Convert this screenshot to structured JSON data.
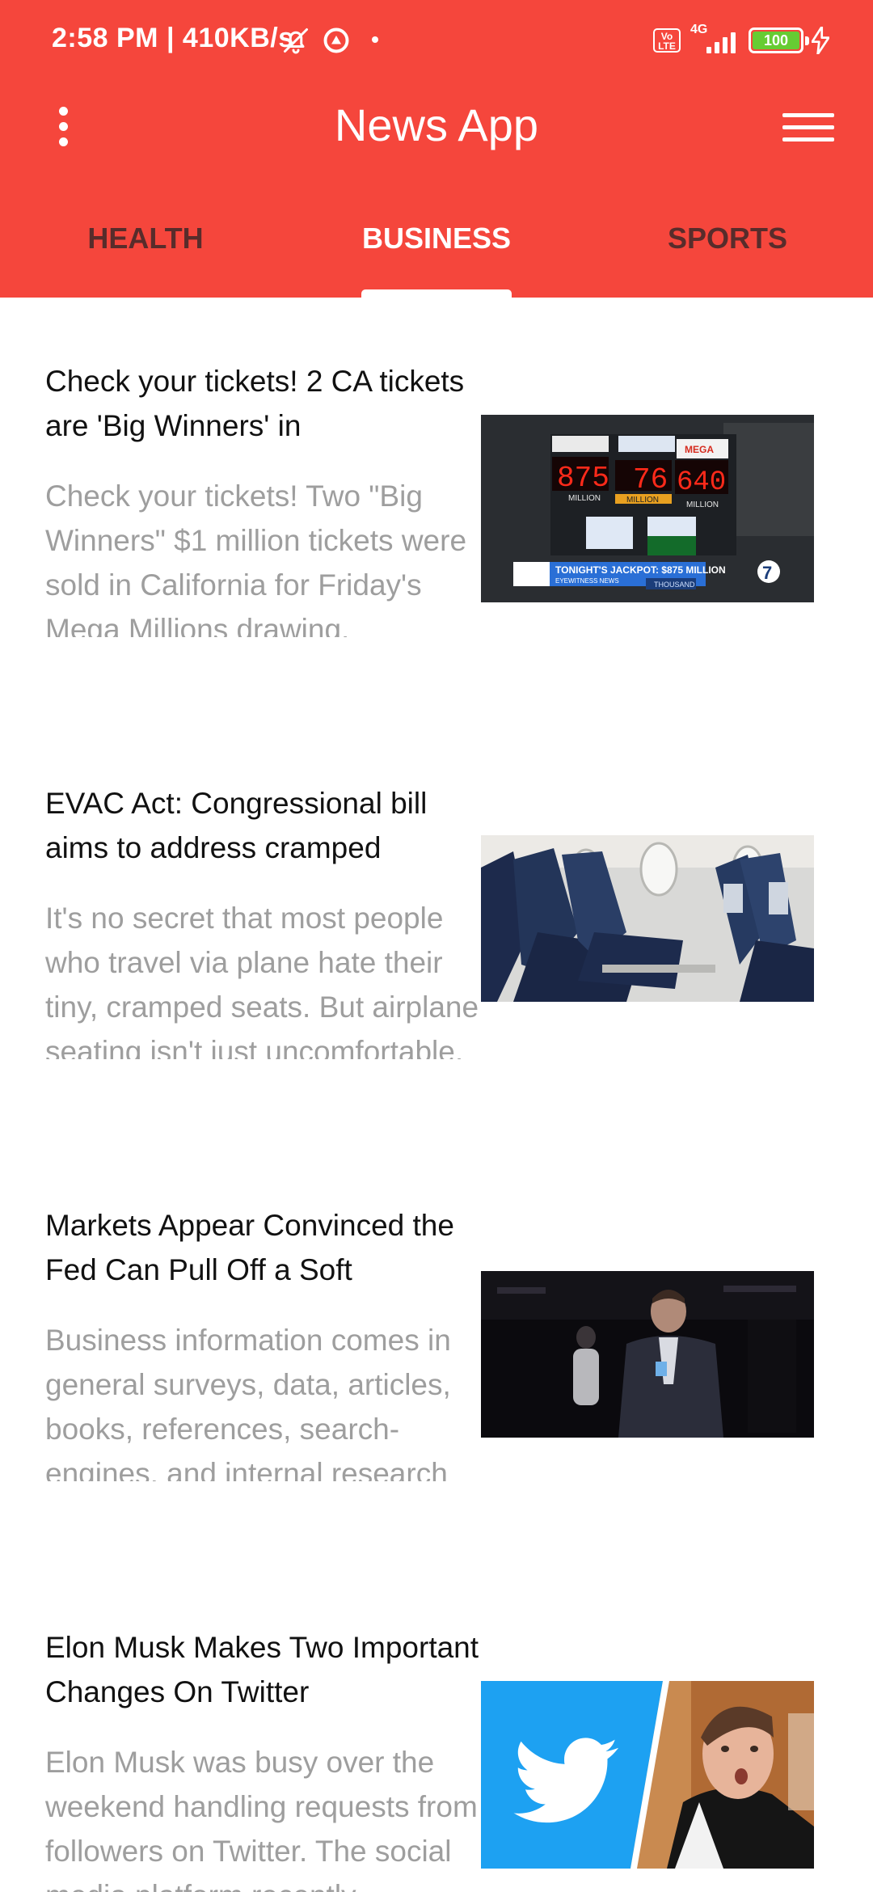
{
  "status_bar": {
    "time": "2:58 PM",
    "speed": "410KB/s",
    "network": "4G",
    "volte": "Vo LTE",
    "battery": "100"
  },
  "app_bar": {
    "title": "News App",
    "menu_icon": "kebab-menu-icon",
    "drawer_icon": "hamburger-icon"
  },
  "tabs": [
    {
      "label": "HEALTH",
      "active": false
    },
    {
      "label": "BUSINESS",
      "active": true
    },
    {
      "label": "SPORTS",
      "active": false
    }
  ],
  "articles": [
    {
      "title": "Check your tickets! 2 CA tickets are 'Big Winners' in",
      "description": "Check your tickets! Two \"Big Winners\" $1 million tickets were sold in California for Friday's Mega Millions drawing.",
      "image": {
        "jackpot_values": [
          "875",
          "76",
          "640"
        ],
        "jackpot_units": [
          "MILLION",
          "MILLION",
          "MILLION"
        ],
        "banner": "TONIGHT'S JACKPOT: $875 MILLION",
        "banner_sub": "EYEWITNESS NEWS",
        "thousand": "THOUSAND",
        "channel": "7"
      }
    },
    {
      "title": "EVAC Act: Congressional bill aims to address cramped",
      "description": "It's no secret that most people who travel via plane hate their tiny, cramped seats. But airplane seating isn't just uncomfortable, it might be"
    },
    {
      "title": "Markets Appear Convinced the Fed Can Pull Off a Soft",
      "description": "Business information comes in general surveys, data, articles, books, references, search-engines, and internal research about a business"
    },
    {
      "title": "Elon Musk Makes Two Important Changes On Twitter",
      "description": "Elon Musk was busy over the weekend handling requests from followers on Twitter. The social media platform recently"
    }
  ],
  "colors": {
    "primary": "#f5463c",
    "tab_active": "#ffffff",
    "title_text": "#111111",
    "desc_text": "#9e9e9e",
    "battery_fill": "#66cc33",
    "twitter_blue": "#1da1f2"
  }
}
